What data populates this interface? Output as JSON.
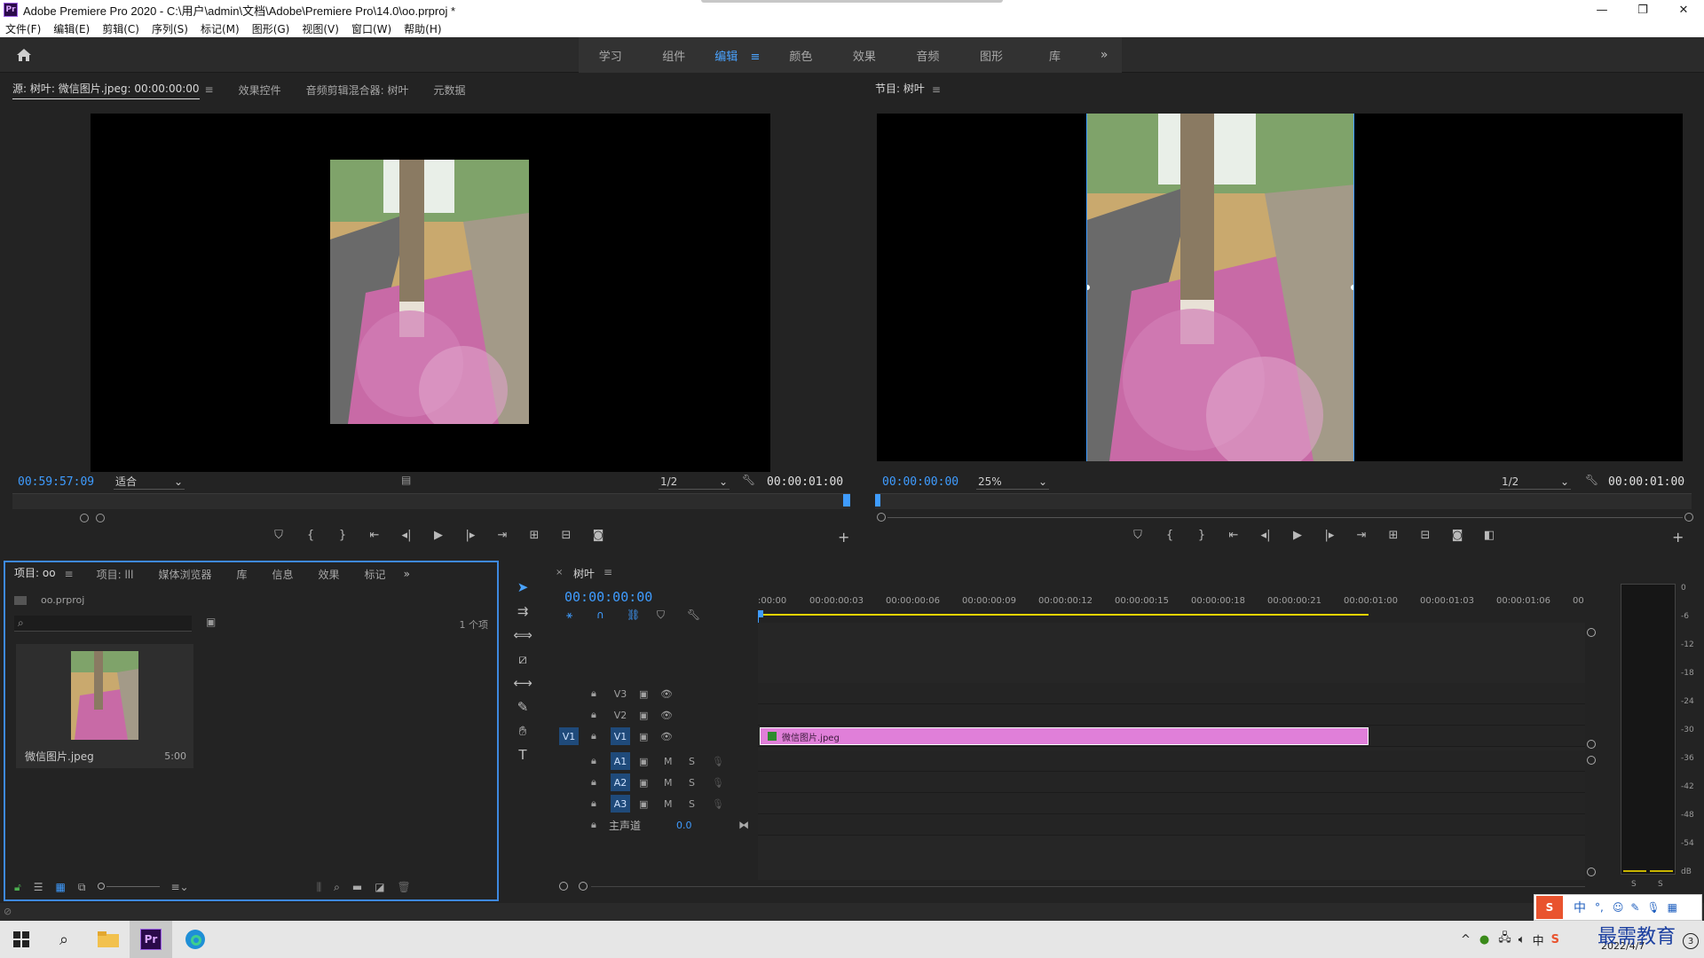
{
  "window": {
    "app_logo": "Pr",
    "title": "Adobe Premiere Pro 2020 - C:\\用户\\admin\\文档\\Adobe\\Premiere Pro\\14.0\\oo.prproj *",
    "minimize": "—",
    "restore": "❐",
    "close": "✕"
  },
  "menu": [
    "文件(F)",
    "编辑(E)",
    "剪辑(C)",
    "序列(S)",
    "标记(M)",
    "图形(G)",
    "视图(V)",
    "窗口(W)",
    "帮助(H)"
  ],
  "workspaces": {
    "items": [
      "学习",
      "组件",
      "编辑",
      "颜色",
      "效果",
      "音频",
      "图形",
      "库"
    ],
    "active": "编辑",
    "menu_glyph": "≡",
    "more": "»"
  },
  "source_panel": {
    "tabs": [
      "源: 树叶: 微信图片.jpeg: 00:00:00:00",
      "效果控件",
      "音频剪辑混合器: 树叶",
      "元数据"
    ],
    "timecode": "00:59:57:09",
    "zoom": "适合",
    "resolution": "1/2",
    "duration": "00:00:01:00"
  },
  "program_panel": {
    "tab": "节目: 树叶",
    "timecode": "00:00:00:00",
    "zoom": "25%",
    "resolution": "1/2",
    "duration": "00:00:01:00"
  },
  "project_panel": {
    "tabs": [
      "项目: oo",
      "项目: lll",
      "媒体浏览器",
      "库",
      "信息",
      "效果",
      "标记"
    ],
    "project_file": "oo.prproj",
    "search_placeholder": "",
    "item_count": "1 个项",
    "item_name": "微信图片.jpeg",
    "item_duration": "5:00"
  },
  "timeline": {
    "tab": "树叶",
    "timecode": "00:00:00:00",
    "ruler": [
      ":00:00",
      "00:00:00:03",
      "00:00:00:06",
      "00:00:00:09",
      "00:00:00:12",
      "00:00:00:15",
      "00:00:00:18",
      "00:00:00:21",
      "00:00:01:00",
      "00:00:01:03",
      "00:00:01:06",
      "00"
    ],
    "video_tracks": [
      "V3",
      "V2",
      "V1"
    ],
    "audio_tracks": [
      "A1",
      "A2",
      "A3"
    ],
    "source_patch_v": "V1",
    "mute_label": "M",
    "solo_label": "S",
    "master_label": "主声道",
    "master_value": "0.0",
    "clip_name": "微信图片.jpeg",
    "clip_color": "#e07fd9"
  },
  "meter": {
    "scale": [
      "0",
      "-6",
      "-12",
      "-18",
      "-24",
      "-30",
      "-36",
      "-42",
      "-48",
      "-54",
      "dB"
    ],
    "solo_left": "S",
    "solo_right": "S"
  },
  "taskbar": {
    "date": "2022/4/7",
    "watermark": "最需教育",
    "ime": "中",
    "pr_label": "Pr",
    "tray_badge": "3"
  },
  "colors": {
    "accent": "#3f9cff",
    "clip": "#e07fd9",
    "work_area": "#e6d400"
  }
}
